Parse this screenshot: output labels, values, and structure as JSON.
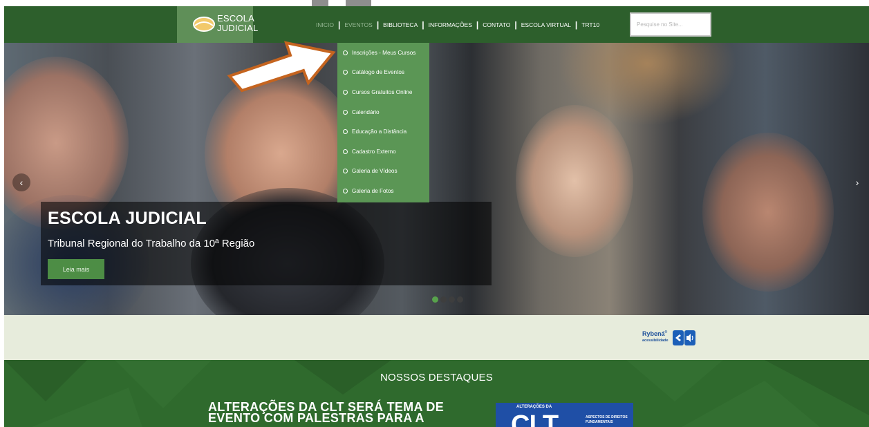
{
  "logo": {
    "line1": "ESCOLA",
    "line2": "JUDICIAL"
  },
  "nav": {
    "items": [
      "INICIO",
      "EVENTOS",
      "BIBLIOTECA",
      "INFORMAÇÕES",
      "CONTATO",
      "ESCOLA VIRTUAL",
      "TRT10"
    ],
    "separator": "|"
  },
  "search": {
    "placeholder": "Pesquise no Site..."
  },
  "dropdown": {
    "items": [
      "Inscrições - Meus Cursos",
      "Catálogo de Eventos",
      "Cursos Gratuitos Online",
      "Calendário",
      "Educação a Distância",
      "Cadastro Externo",
      "Galeria de Vídeos",
      "Galeria de Fotos"
    ]
  },
  "hero": {
    "title": "ESCOLA JUDICIAL",
    "subtitle": "Tribunal Regional do Trabalho da 10ª Região",
    "button": "Leia mais",
    "prev": "‹",
    "next": "›"
  },
  "accessibility": {
    "brand": "Rybená",
    "mark": "®",
    "sub": "acessibilidade"
  },
  "highlights": {
    "title": "NOSSOS DESTAQUES",
    "news_line1": "ALTERAÇÕES DA CLT SERÁ TEMA DE",
    "news_line2": "EVENTO COM PALESTRAS PARA A",
    "thumb_top": "ALTERAÇÕES DA",
    "thumb_big": "CLT",
    "thumb_right1": "ASPECTOS DE DIREITOS",
    "thumb_right2": "FUNDAMENTAIS"
  },
  "colors": {
    "nav_bg": "#2d5f2c",
    "logo_bg": "#5f8f58",
    "dropdown_bg": "#5b9655",
    "strip_bg": "#e7ecdc",
    "highlights_bg": "#2f6a2d",
    "button": "#4d8d45",
    "arrow_fill": "#ffffff",
    "arrow_stroke": "#c5641f"
  }
}
